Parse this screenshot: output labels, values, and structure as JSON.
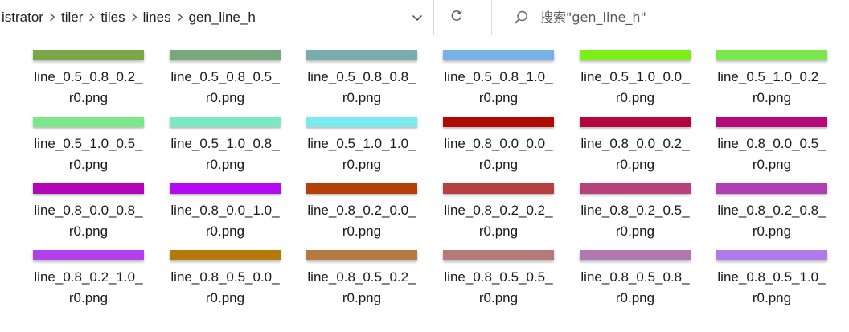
{
  "address_bar": {
    "crumbs": [
      "istrator",
      "tiler",
      "tiles",
      "lines",
      "gen_line_h"
    ]
  },
  "search": {
    "placeholder": "搜索\"gen_line_h\""
  },
  "icons": {
    "separator": "chevron-right-icon",
    "dropdown": "chevron-down-icon",
    "refresh": "refresh-icon",
    "search": "search-icon"
  },
  "files": [
    {
      "line1": "line_0.5_0.8_0.2_",
      "line2": "r0.png",
      "color": "#7aa646"
    },
    {
      "line1": "line_0.5_0.8_0.5_",
      "line2": "r0.png",
      "color": "#79a87f"
    },
    {
      "line1": "line_0.5_0.8_0.8_",
      "line2": "r0.png",
      "color": "#79adad"
    },
    {
      "line1": "line_0.5_0.8_1.0_",
      "line2": "r0.png",
      "color": "#79b1e6"
    },
    {
      "line1": "line_0.5_1.0_0.0_",
      "line2": "r0.png",
      "color": "#7aef18"
    },
    {
      "line1": "line_0.5_1.0_0.2_",
      "line2": "r0.png",
      "color": "#7ae84a"
    },
    {
      "line1": "line_0.5_1.0_0.5_",
      "line2": "r0.png",
      "color": "#7ae888"
    },
    {
      "line1": "line_0.5_1.0_0.8_",
      "line2": "r0.png",
      "color": "#7ae8c0"
    },
    {
      "line1": "line_0.5_1.0_1.0_",
      "line2": "r0.png",
      "color": "#7aeaef"
    },
    {
      "line1": "line_0.8_0.0_0.0_",
      "line2": "r0.png",
      "color": "#b00b00"
    },
    {
      "line1": "line_0.8_0.0_0.2_",
      "line2": "r0.png",
      "color": "#b50540"
    },
    {
      "line1": "line_0.8_0.0_0.5_",
      "line2": "r0.png",
      "color": "#b5097a"
    },
    {
      "line1": "line_0.8_0.0_0.8_",
      "line2": "r0.png",
      "color": "#b006b6"
    },
    {
      "line1": "line_0.8_0.0_1.0_",
      "line2": "r0.png",
      "color": "#b20bef"
    },
    {
      "line1": "line_0.8_0.2_0.0_",
      "line2": "r0.png",
      "color": "#b5400a"
    },
    {
      "line1": "line_0.8_0.2_0.2_",
      "line2": "r0.png",
      "color": "#b5403f"
    },
    {
      "line1": "line_0.8_0.2_0.5_",
      "line2": "r0.png",
      "color": "#b5427a"
    },
    {
      "line1": "line_0.8_0.2_0.8_",
      "line2": "r0.png",
      "color": "#b040b1"
    },
    {
      "line1": "line_0.8_0.2_1.0_",
      "line2": "r0.png",
      "color": "#b140eb"
    },
    {
      "line1": "line_0.8_0.5_0.0_",
      "line2": "r0.png",
      "color": "#b57a09"
    },
    {
      "line1": "line_0.8_0.5_0.2_",
      "line2": "r0.png",
      "color": "#b57a41"
    },
    {
      "line1": "line_0.8_0.5_0.5_",
      "line2": "r0.png",
      "color": "#b57b7b"
    },
    {
      "line1": "line_0.8_0.5_0.8_",
      "line2": "r0.png",
      "color": "#b07ab1"
    },
    {
      "line1": "line_0.8_0.5_1.0_",
      "line2": "r0.png",
      "color": "#b27bec"
    }
  ]
}
